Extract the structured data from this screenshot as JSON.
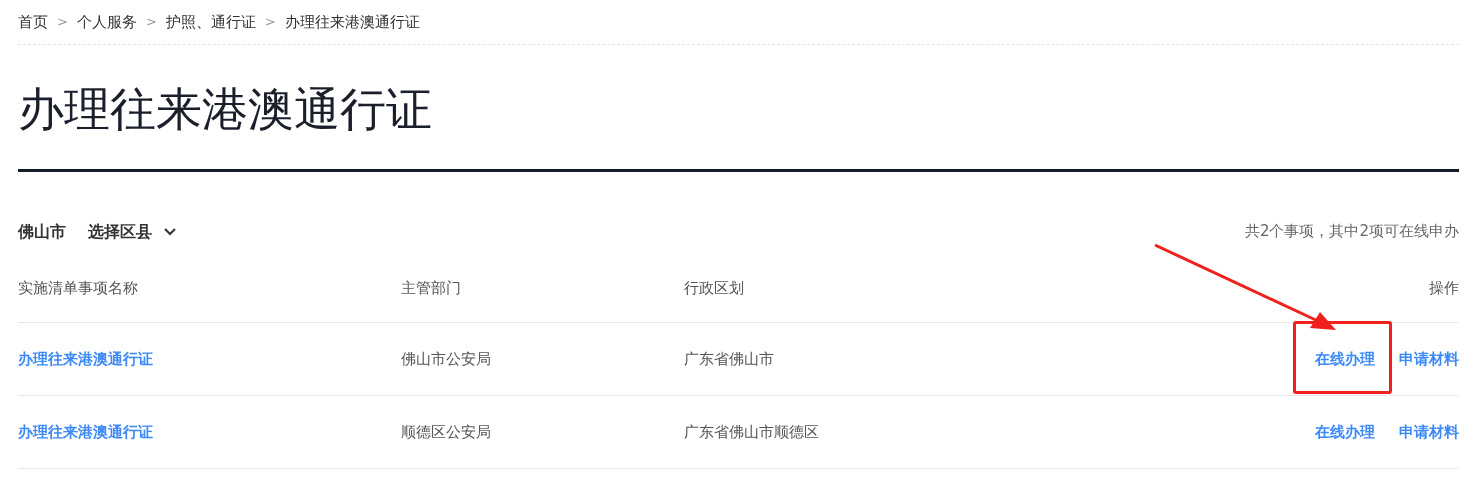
{
  "breadcrumb": {
    "separator": ">",
    "items": [
      "首页",
      "个人服务",
      "护照、通行证",
      "办理往来港澳通行证"
    ]
  },
  "title": "办理往来港澳通行证",
  "filter": {
    "city": "佛山市",
    "district_select": "选择区县",
    "summary": "共2个事项，其中2项可在线申办"
  },
  "table": {
    "columns": [
      "实施清单事项名称",
      "主管部门",
      "行政区划",
      "操作"
    ],
    "rows": [
      {
        "name": "办理往来港澳通行证",
        "department": "佛山市公安局",
        "region": "广东省佛山市",
        "actions": [
          {
            "label": "在线办理",
            "highlighted": true
          },
          {
            "label": "申请材料",
            "highlighted": false
          }
        ]
      },
      {
        "name": "办理往来港澳通行证",
        "department": "顺德区公安局",
        "region": "广东省佛山市顺德区",
        "actions": [
          {
            "label": "在线办理",
            "highlighted": false
          },
          {
            "label": "申请材料",
            "highlighted": false
          }
        ]
      }
    ]
  }
}
